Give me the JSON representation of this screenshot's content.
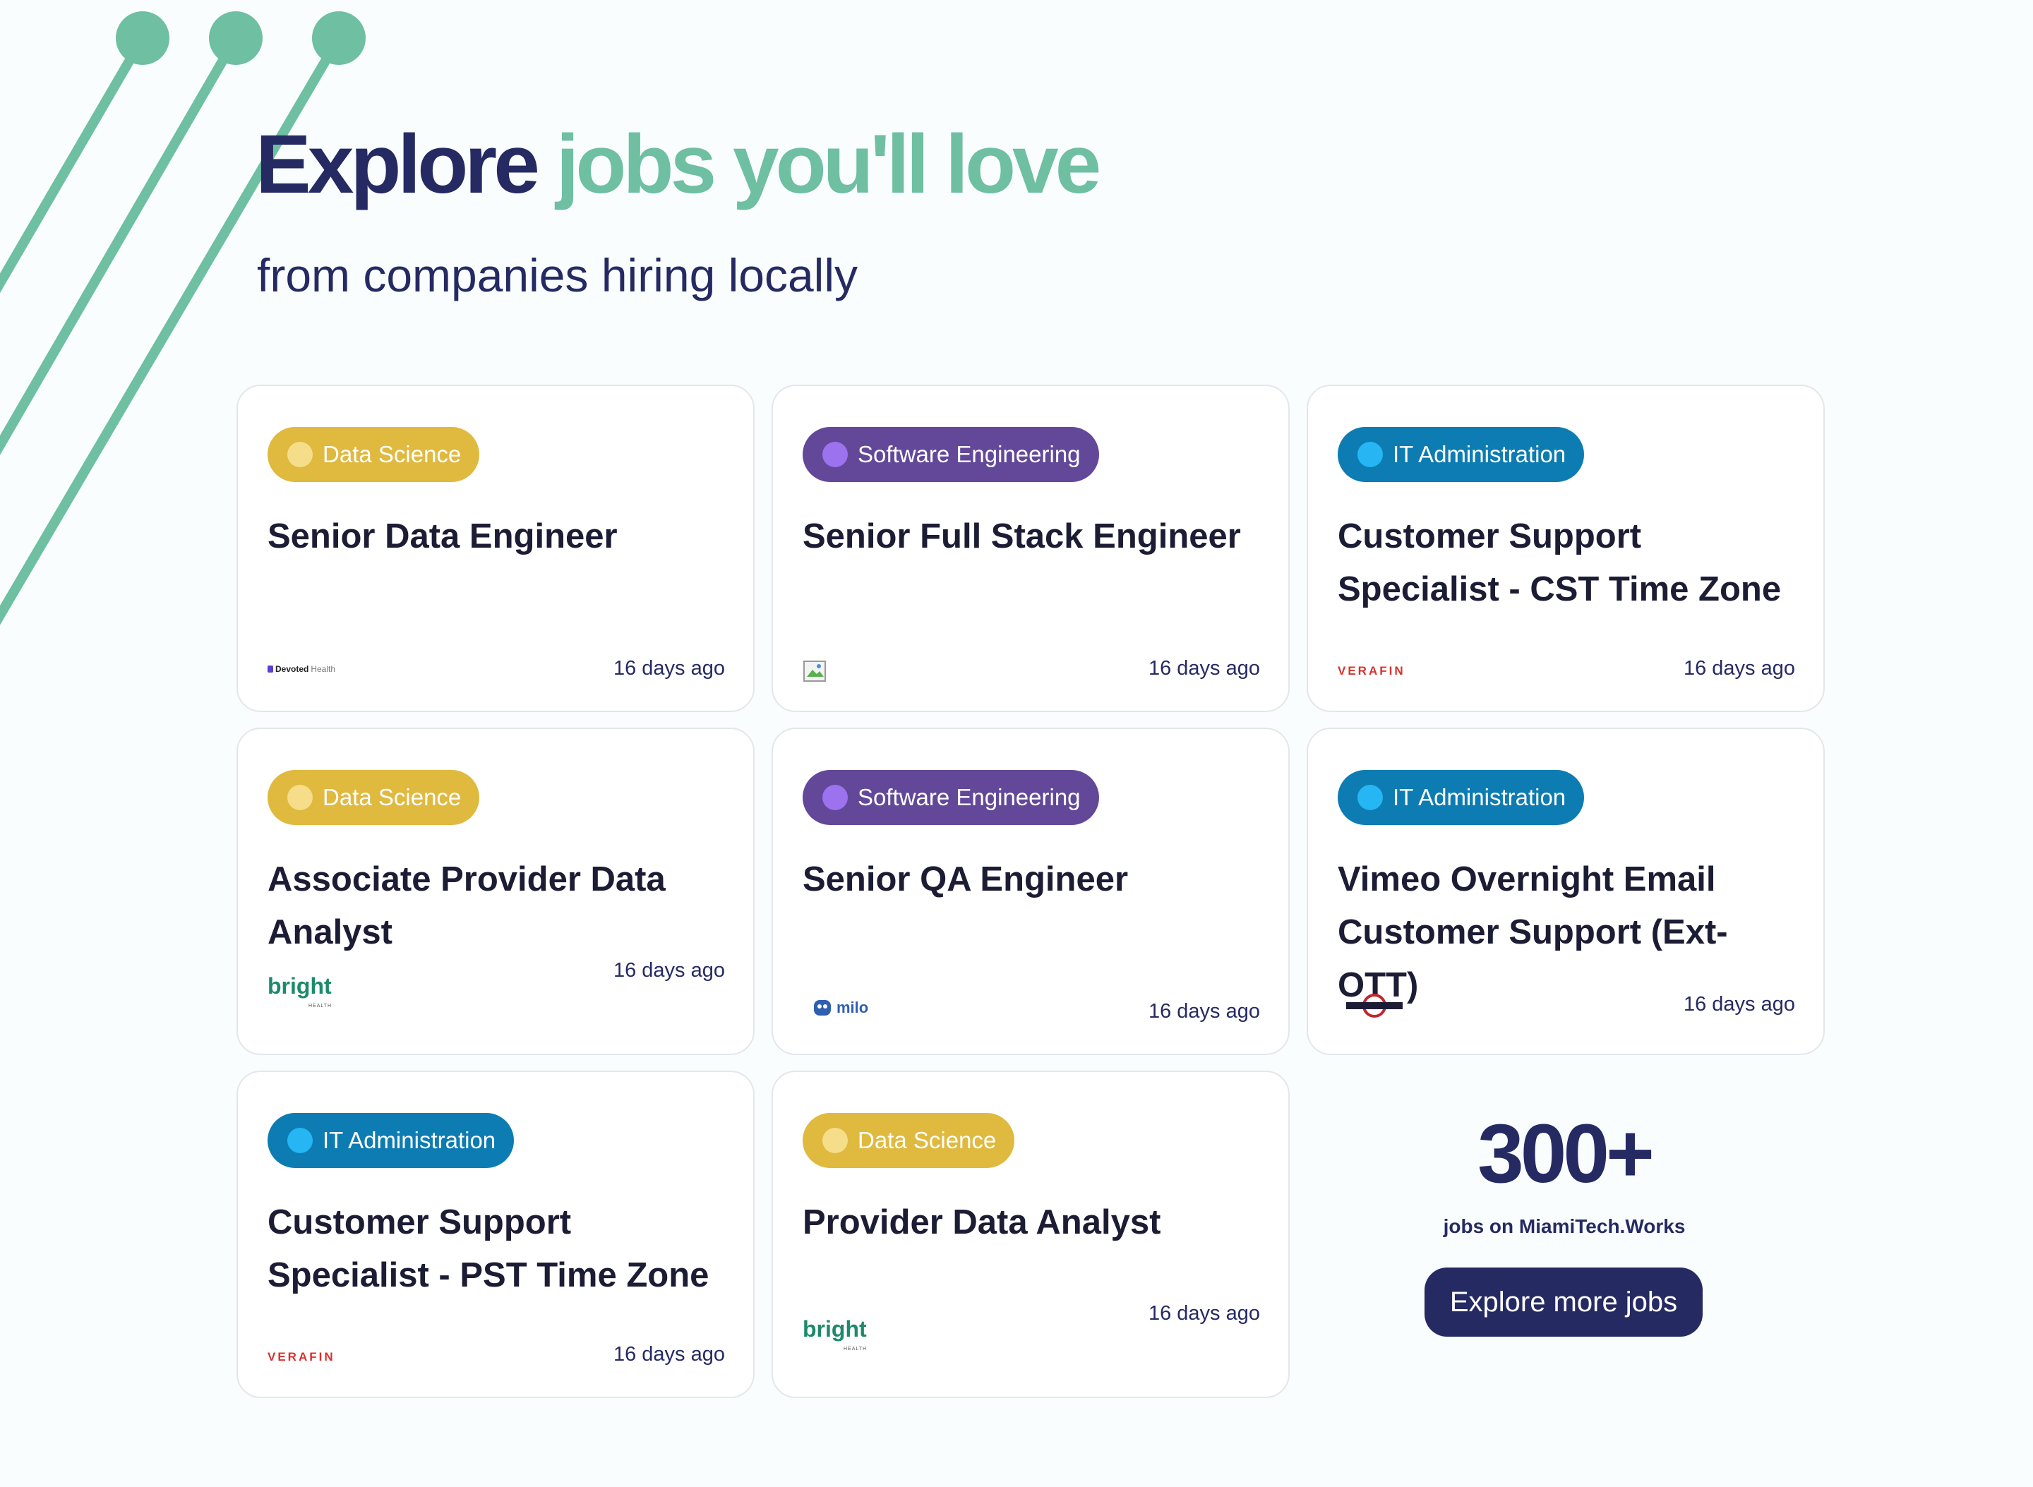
{
  "hero": {
    "title_dark": "Explore",
    "title_accent": "jobs you'll love",
    "subtitle": "from companies hiring locally"
  },
  "colors": {
    "brand_navy": "#262a62",
    "brand_green": "#6fbfa2",
    "data_science": "#e0b93f",
    "software_engineering": "#63489a",
    "it_administration": "#0d7cb2"
  },
  "jobs": [
    {
      "category": "Data Science",
      "title": "Senior Data Engineer",
      "posted": "16 days ago",
      "company_logo": "DevotedHealth"
    },
    {
      "category": "Software Engineering",
      "title": "Senior Full Stack Engineer",
      "posted": "16 days ago",
      "company_logo": "broken-image-icon"
    },
    {
      "category": "IT Administration",
      "title": "Customer Support Specialist - CST Time Zone",
      "posted": "16 days ago",
      "company_logo": "VERAFIN"
    },
    {
      "category": "Data Science",
      "title": "Associate Provider Data Analyst",
      "posted": "16 days ago",
      "company_logo": "bright"
    },
    {
      "category": "Software Engineering",
      "title": "Senior QA Engineer",
      "posted": "16 days ago",
      "company_logo": "milo"
    },
    {
      "category": "IT Administration",
      "title": "Vimeo Overnight Email Customer Support (Ext-OTT)",
      "posted": "16 days ago",
      "company_logo": "modsquad-logo"
    },
    {
      "category": "IT Administration",
      "title": "Customer Support Specialist - PST Time Zone",
      "posted": "16 days ago",
      "company_logo": "VERAFIN"
    },
    {
      "category": "Data Science",
      "title": "Provider Data Analyst",
      "posted": "16 days ago",
      "company_logo": "bright"
    }
  ],
  "logos": {
    "devoted_a": "Devoted",
    "devoted_b": "Health",
    "verafin": "VERAFIN",
    "bright": "bright",
    "bright_sub": "HEALTH",
    "milo": "milo"
  },
  "cta": {
    "count": "300+",
    "label": "jobs on MiamiTech.Works",
    "button": "Explore more jobs"
  }
}
